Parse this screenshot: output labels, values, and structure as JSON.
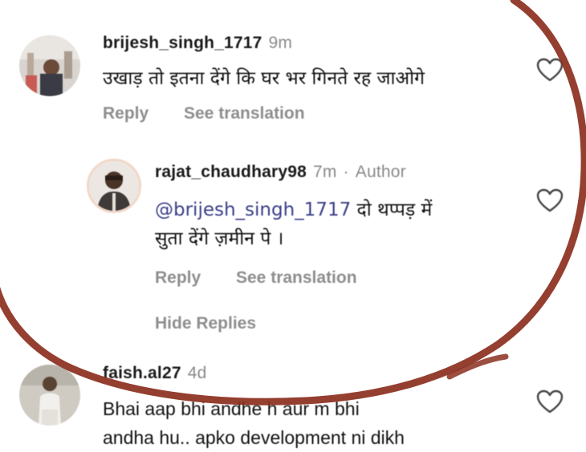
{
  "comments": [
    {
      "username": "brijesh_singh_1717",
      "time": "9m",
      "text": "उखाड़ तो इतना देंगे कि घर भर गिनते रह जाओगे",
      "reply_label": "Reply",
      "translate_label": "See translation"
    },
    {
      "username": "rajat_chaudhary98",
      "time": "7m",
      "separator": "·",
      "badge": "Author",
      "mention": "@brijesh_singh_1717",
      "text_line1": " दो थप्पड़ में",
      "text_line2": "सुता देंगे ज़मीन पे ।",
      "reply_label": "Reply",
      "translate_label": "See translation",
      "hide_replies_label": "Hide Replies"
    },
    {
      "username": "faish.al27",
      "time": "4d",
      "text_line1": "Bhai aap bhi andhe h aur m bhi",
      "text_line2": "andha hu.. apko development ni dikh"
    }
  ],
  "colors": {
    "circle_annotation": "#8b2f1e",
    "muted_text": "#8e8e8e",
    "mention": "#3b3f8a"
  }
}
